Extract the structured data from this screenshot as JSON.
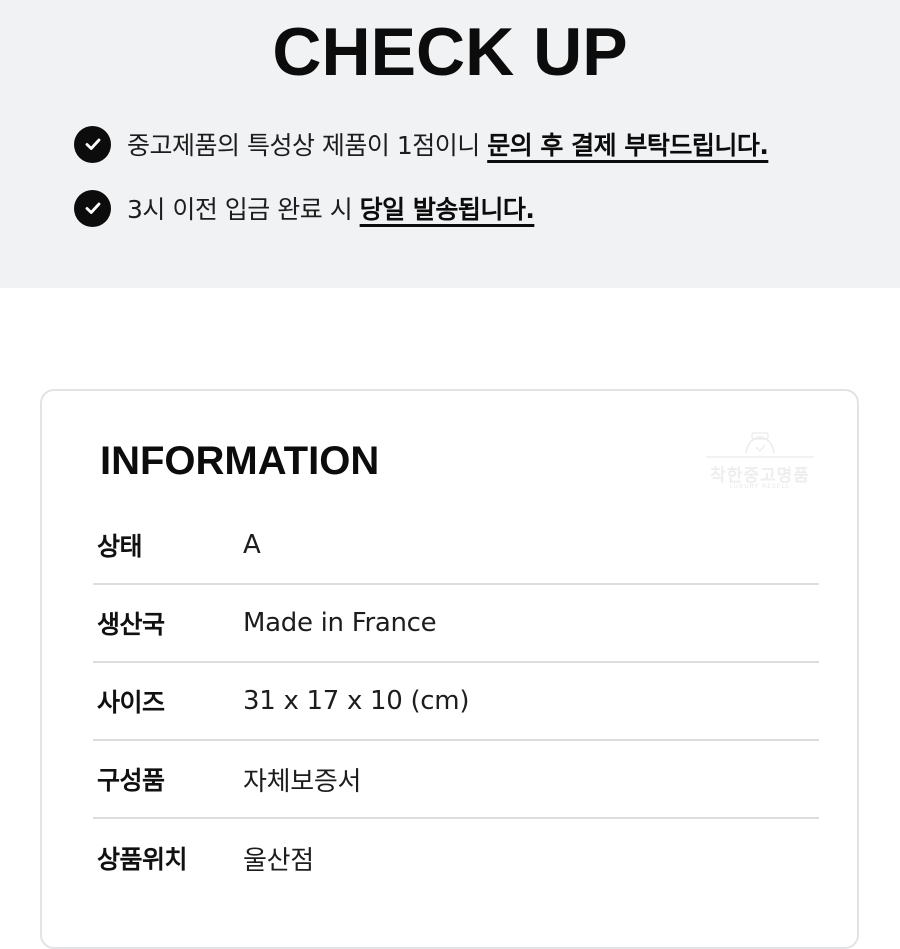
{
  "checkup": {
    "title": "CHECK UP",
    "notices": [
      {
        "icon": "check-circle-icon",
        "text": "중고제품의 특성상 제품이 1점이니 ",
        "emphasis": "문의 후 결제 부탁드립니다."
      },
      {
        "icon": "check-circle-icon",
        "text": "3시 이전 입금 완료 시 ",
        "emphasis": "당일 발송됩니다."
      }
    ]
  },
  "information": {
    "title": "INFORMATION",
    "watermark": {
      "icon": "watch-logo-icon",
      "text": "착한중고명품",
      "subtext": "LUXURY RESELL"
    },
    "rows": [
      {
        "label": "상태",
        "value": "A"
      },
      {
        "label": "생산국",
        "value": "Made in France"
      },
      {
        "label": "사이즈",
        "value": "31 x 17 x 10 (cm)"
      },
      {
        "label": "구성품",
        "value": "자체보증서"
      },
      {
        "label": "상품위치",
        "value": "울산점"
      }
    ]
  },
  "colors": {
    "header_bg": "#f1f2f4",
    "text": "#0c0c0c",
    "divider": "#dddddd",
    "card_border": "#e2e3e5"
  }
}
